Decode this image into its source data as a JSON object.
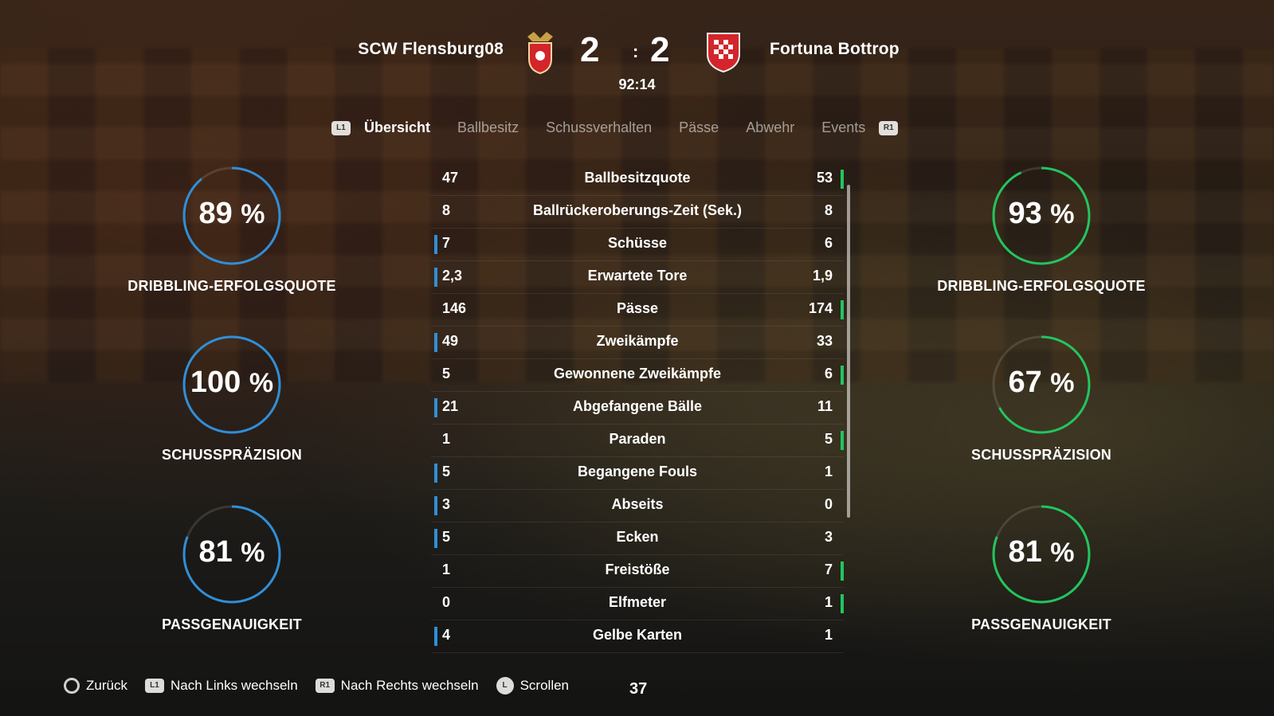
{
  "match": {
    "home_team": "SCW Flensburg08",
    "away_team": "Fortuna Bottrop",
    "home_score": "2",
    "away_score": "2",
    "separator": ":",
    "clock": "92:14"
  },
  "tabs": {
    "left_badge": "L1",
    "right_badge": "R1",
    "items": [
      "Übersicht",
      "Ballbesitz",
      "Schussverhalten",
      "Pässe",
      "Abwehr",
      "Events"
    ],
    "active": "Übersicht"
  },
  "home_circles": [
    {
      "value": "89",
      "unit": "%",
      "fraction": 0.89,
      "label": "DRIBBLING-ERFOLGSQUOTE"
    },
    {
      "value": "100",
      "unit": "%",
      "fraction": 1.0,
      "label": "SCHUSSPRÄZISION"
    },
    {
      "value": "81",
      "unit": "%",
      "fraction": 0.81,
      "label": "PASSGENAUIGKEIT"
    }
  ],
  "away_circles": [
    {
      "value": "93",
      "unit": "%",
      "fraction": 0.93,
      "label": "DRIBBLING-ERFOLGSQUOTE"
    },
    {
      "value": "67",
      "unit": "%",
      "fraction": 0.67,
      "label": "SCHUSSPRÄZISION"
    },
    {
      "value": "81",
      "unit": "%",
      "fraction": 0.81,
      "label": "PASSGENAUIGKEIT"
    }
  ],
  "colors": {
    "home_accent": "#2f8fd8",
    "away_accent": "#22c55e"
  },
  "stats": [
    {
      "home": "47",
      "label": "Ballbesitzquote",
      "away": "53",
      "leader": "away"
    },
    {
      "home": "8",
      "label": "Ballrückeroberungs-Zeit (Sek.)",
      "away": "8",
      "leader": "none"
    },
    {
      "home": "7",
      "label": "Schüsse",
      "away": "6",
      "leader": "home"
    },
    {
      "home": "2,3",
      "label": "Erwartete Tore",
      "away": "1,9",
      "leader": "home"
    },
    {
      "home": "146",
      "label": "Pässe",
      "away": "174",
      "leader": "away"
    },
    {
      "home": "49",
      "label": "Zweikämpfe",
      "away": "33",
      "leader": "home"
    },
    {
      "home": "5",
      "label": "Gewonnene Zweikämpfe",
      "away": "6",
      "leader": "away"
    },
    {
      "home": "21",
      "label": "Abgefangene Bälle",
      "away": "11",
      "leader": "home"
    },
    {
      "home": "1",
      "label": "Paraden",
      "away": "5",
      "leader": "away"
    },
    {
      "home": "5",
      "label": "Begangene Fouls",
      "away": "1",
      "leader": "home"
    },
    {
      "home": "3",
      "label": "Abseits",
      "away": "0",
      "leader": "home"
    },
    {
      "home": "5",
      "label": "Ecken",
      "away": "3",
      "leader": "home"
    },
    {
      "home": "1",
      "label": "Freistöße",
      "away": "7",
      "leader": "away"
    },
    {
      "home": "0",
      "label": "Elfmeter",
      "away": "1",
      "leader": "away"
    },
    {
      "home": "4",
      "label": "Gelbe Karten",
      "away": "1",
      "leader": "home"
    }
  ],
  "footer": {
    "back": "Zurück",
    "left_badge": "L1",
    "left": "Nach Links wechseln",
    "right_badge": "R1",
    "right": "Nach Rechts wechseln",
    "stick_badge": "L",
    "scroll": "Scrollen",
    "page": "37"
  }
}
